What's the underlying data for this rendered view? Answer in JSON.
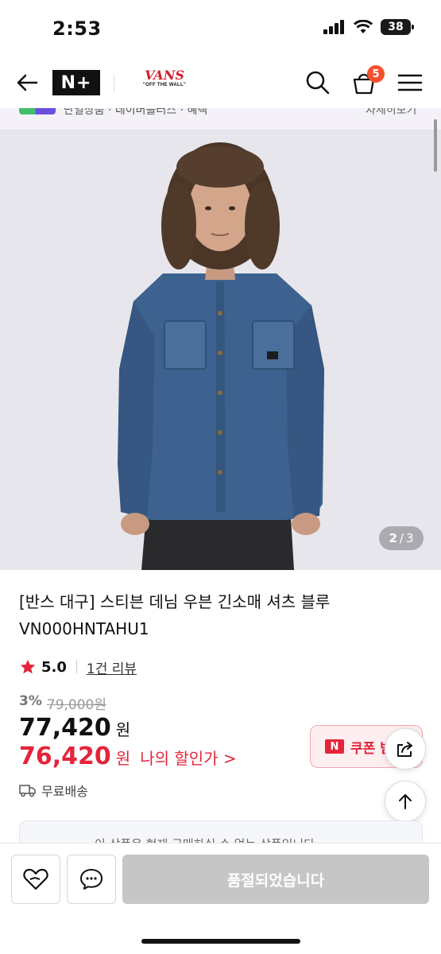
{
  "status_bar": {
    "time": "2:53",
    "battery": "38"
  },
  "header": {
    "nplus_logo": "N+",
    "brand_logo": "VANS",
    "brand_tagline": "\"OFF THE WALL\"",
    "cart_count": "5"
  },
  "promo": {
    "text": "단일상품 · 네이버플러스 · 혜택",
    "right": "자세히보기"
  },
  "gallery": {
    "current": "2",
    "separator": "/",
    "total": "3"
  },
  "product": {
    "title": "[반스 대구] 스티븐 데님 우븐 긴소매 셔츠 블루 VN000HNTAHU1",
    "rating": "5.0",
    "review_link": "1건 리뷰",
    "discount_rate": "3%",
    "original_price": "79,000원",
    "price": "77,420",
    "price_unit": "원",
    "my_price": "76,420",
    "my_price_unit": "원",
    "my_price_link": "나의 할인가 >",
    "shipping": "무료배송",
    "coupon_label": "쿠폰 받기"
  },
  "notice": {
    "text": "이 상품은 현재 구매하실 수 없는 상품입니다"
  },
  "bottom_bar": {
    "soldout_label": "품절되었습니다"
  },
  "colors": {
    "accent_red": "#e5243a",
    "brand_red": "#d1202f",
    "badge_orange": "#f4502e",
    "disabled_gray": "#c6c6c6"
  }
}
